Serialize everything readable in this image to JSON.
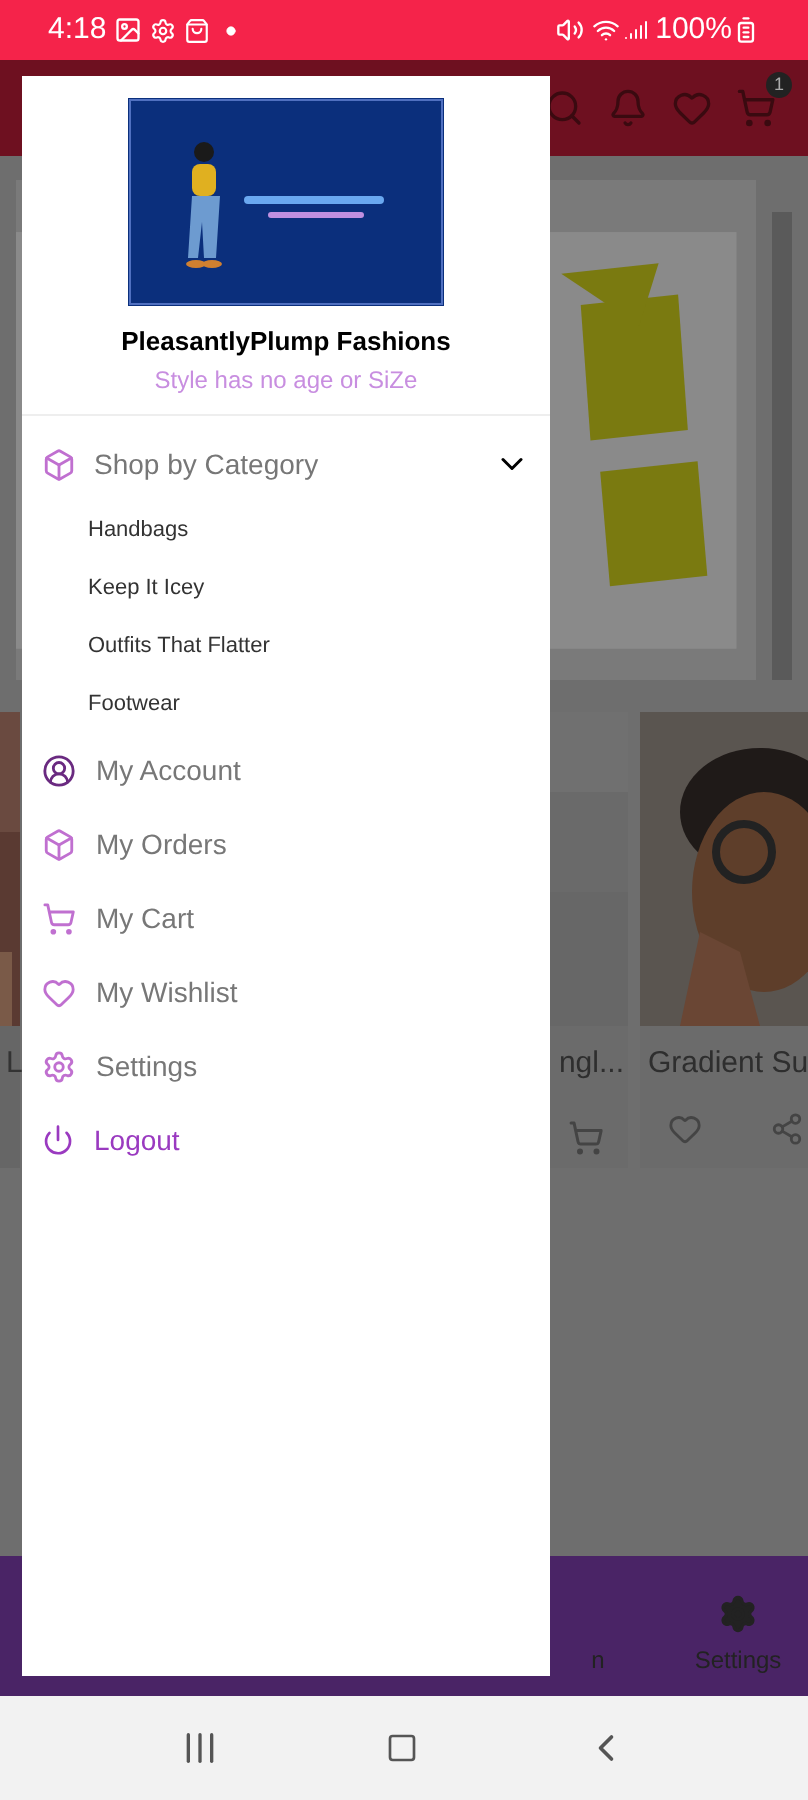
{
  "status_bar": {
    "time": "4:18",
    "battery": "100%"
  },
  "app_bar": {
    "cart_badge": "1"
  },
  "products": [
    {
      "title": "L"
    },
    {
      "title": "ngl..."
    },
    {
      "title": "Gradient Su"
    }
  ],
  "bottom_nav": [
    {
      "label": "n"
    },
    {
      "label": "Settings"
    }
  ],
  "drawer": {
    "brand": "PleasantlyPlump Fashions",
    "tagline": "Style has no age or SiZe",
    "menu": [
      {
        "kind": "group",
        "label": "Shop by Category",
        "expanded": true,
        "children": [
          {
            "label": "Handbags"
          },
          {
            "label": "Keep It Icey"
          },
          {
            "label": "Outfits That Flatter"
          },
          {
            "label": "Footwear"
          }
        ]
      },
      {
        "kind": "item",
        "label": "My Account"
      },
      {
        "kind": "item",
        "label": "My Orders"
      },
      {
        "kind": "item",
        "label": "My Cart"
      },
      {
        "kind": "item",
        "label": "My Wishlist"
      },
      {
        "kind": "item",
        "label": "Settings"
      },
      {
        "kind": "logout",
        "label": "Logout"
      }
    ]
  }
}
